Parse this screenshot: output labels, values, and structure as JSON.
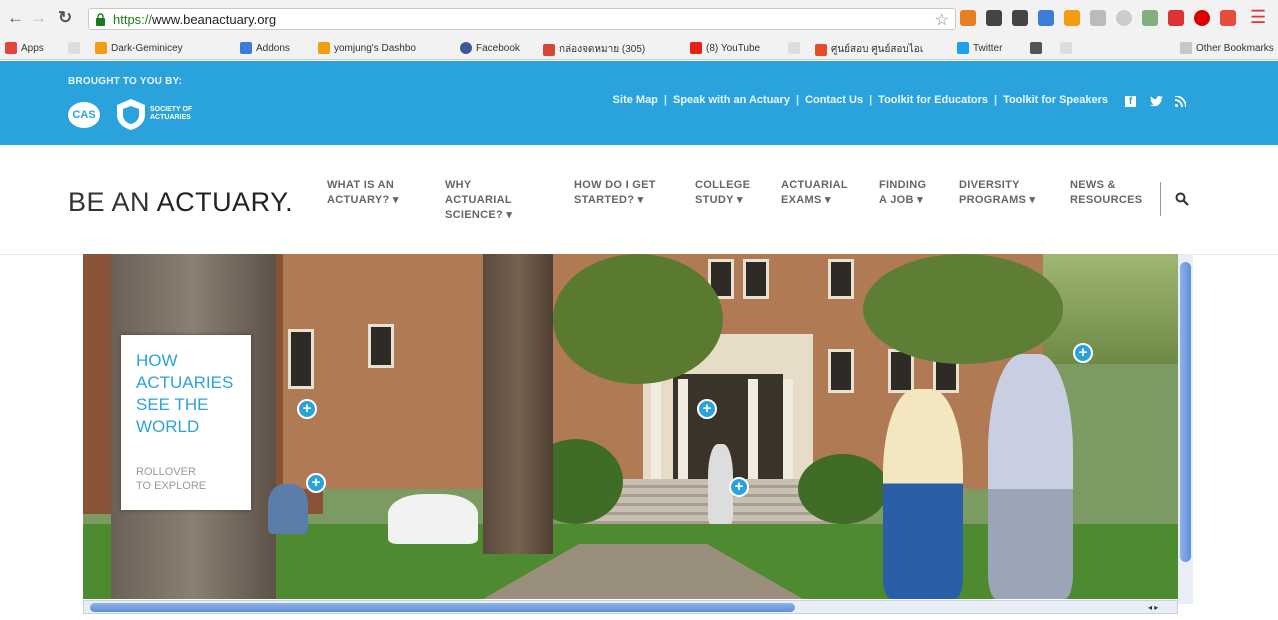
{
  "browser": {
    "url_scheme": "https://",
    "url_host": "www.beanactuary.org",
    "bookmarks": [
      {
        "label": "Apps",
        "color": "#e0463b"
      },
      {
        "label": "Dark-Geminicey",
        "color": "#f39c12"
      },
      {
        "label": "Addons",
        "color": "#3b7dd8"
      },
      {
        "label": "yomjung's Dashbo",
        "color": "#f39c12"
      },
      {
        "label": "Facebook",
        "color": "#3b5998"
      },
      {
        "label": "กล่องจดหมาย (305)",
        "color": "#d44638"
      },
      {
        "label": "(8) YouTube",
        "color": "#e62117"
      },
      {
        "label": "ศูนย์สอบ ศูนย์สอบไอเ",
        "color": "#e34c26"
      },
      {
        "label": "Twitter",
        "color": "#1da1f2"
      },
      {
        "label": "Other Bookmarks",
        "color": "#c7c7c7"
      }
    ]
  },
  "topbar": {
    "brought_by": "BROUGHT TO YOU BY:",
    "cas_label": "CAS",
    "soa_label": "SOCIETY OF ACTUARIES",
    "links": [
      "Site Map",
      "Speak with an Actuary",
      "Contact Us",
      "Toolkit for Educators",
      "Toolkit for Speakers"
    ],
    "separator": "|",
    "social": [
      "f",
      "t",
      "rss"
    ],
    "color": "#2aa3dd"
  },
  "logo": {
    "part1": "BE AN ",
    "part2": "ACTUARY."
  },
  "nav": [
    {
      "label": "WHAT IS AN\nACTUARY?"
    },
    {
      "label": "WHY\nACTUARIAL\nSCIENCE?"
    },
    {
      "label": "HOW DO I GET\nSTARTED?"
    },
    {
      "label": "COLLEGE\nSTUDY"
    },
    {
      "label": "ACTUARIAL\nEXAMS"
    },
    {
      "label": "FINDING\nA JOB"
    },
    {
      "label": "DIVERSITY\nPROGRAMS"
    },
    {
      "label": "NEWS &\nRESOURCES"
    }
  ],
  "hero": {
    "title": "HOW\nACTUARIES\nSEE THE\nWORLD",
    "subtitle": "ROLLOVER\nTO EXPLORE",
    "hotspot_symbol": "+"
  }
}
